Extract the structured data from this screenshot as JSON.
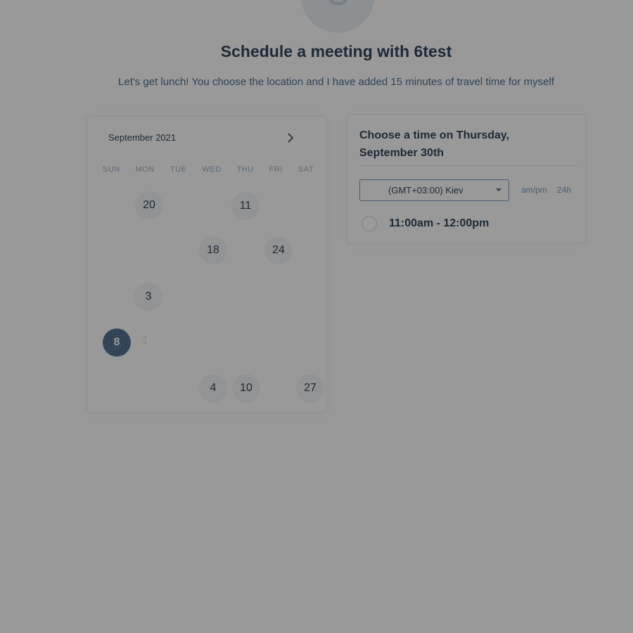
{
  "header": {
    "avatar_letter": "G",
    "title": "Schedule a meeting with 6test",
    "description": "Let's get lunch! You choose the location and I have added 15 minutes of travel time for myself"
  },
  "calendar": {
    "month_label": "September 2021",
    "weekdays": [
      "SUN",
      "MON",
      "TUE",
      "WED",
      "THU",
      "FRI",
      "SAT"
    ],
    "days": [
      "20",
      "11",
      "18",
      "24",
      "3",
      "4",
      "10",
      "27"
    ],
    "selected_day": "8",
    "faded_day": "1"
  },
  "time_panel": {
    "heading": "Choose a time on Thursday, September 30th",
    "timezone": "(GMT+03:00) Kiev",
    "format_ampm": "am/pm",
    "format_24h": "24h",
    "slot": "11:00am - 12:00pm"
  },
  "colors": {
    "overlay": "#000000",
    "text": "#33475b",
    "muted": "#516f90"
  }
}
